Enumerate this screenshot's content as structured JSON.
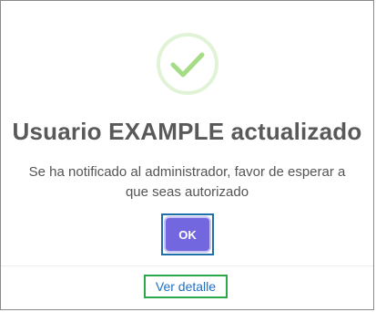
{
  "dialog": {
    "title": "Usuario EXAMPLE actualizado",
    "message": "Se ha notificado al administrador, favor de esperar a que seas autorizado",
    "ok_label": "OK",
    "detail_link_label": "Ver detalle",
    "icon": "success-check-icon"
  },
  "colors": {
    "success": "#a5dc86",
    "confirm_button": "#7367e0",
    "link": "#1d70c4",
    "focus_outline": "#1f6fa8",
    "link_outline": "#2aa84a"
  }
}
